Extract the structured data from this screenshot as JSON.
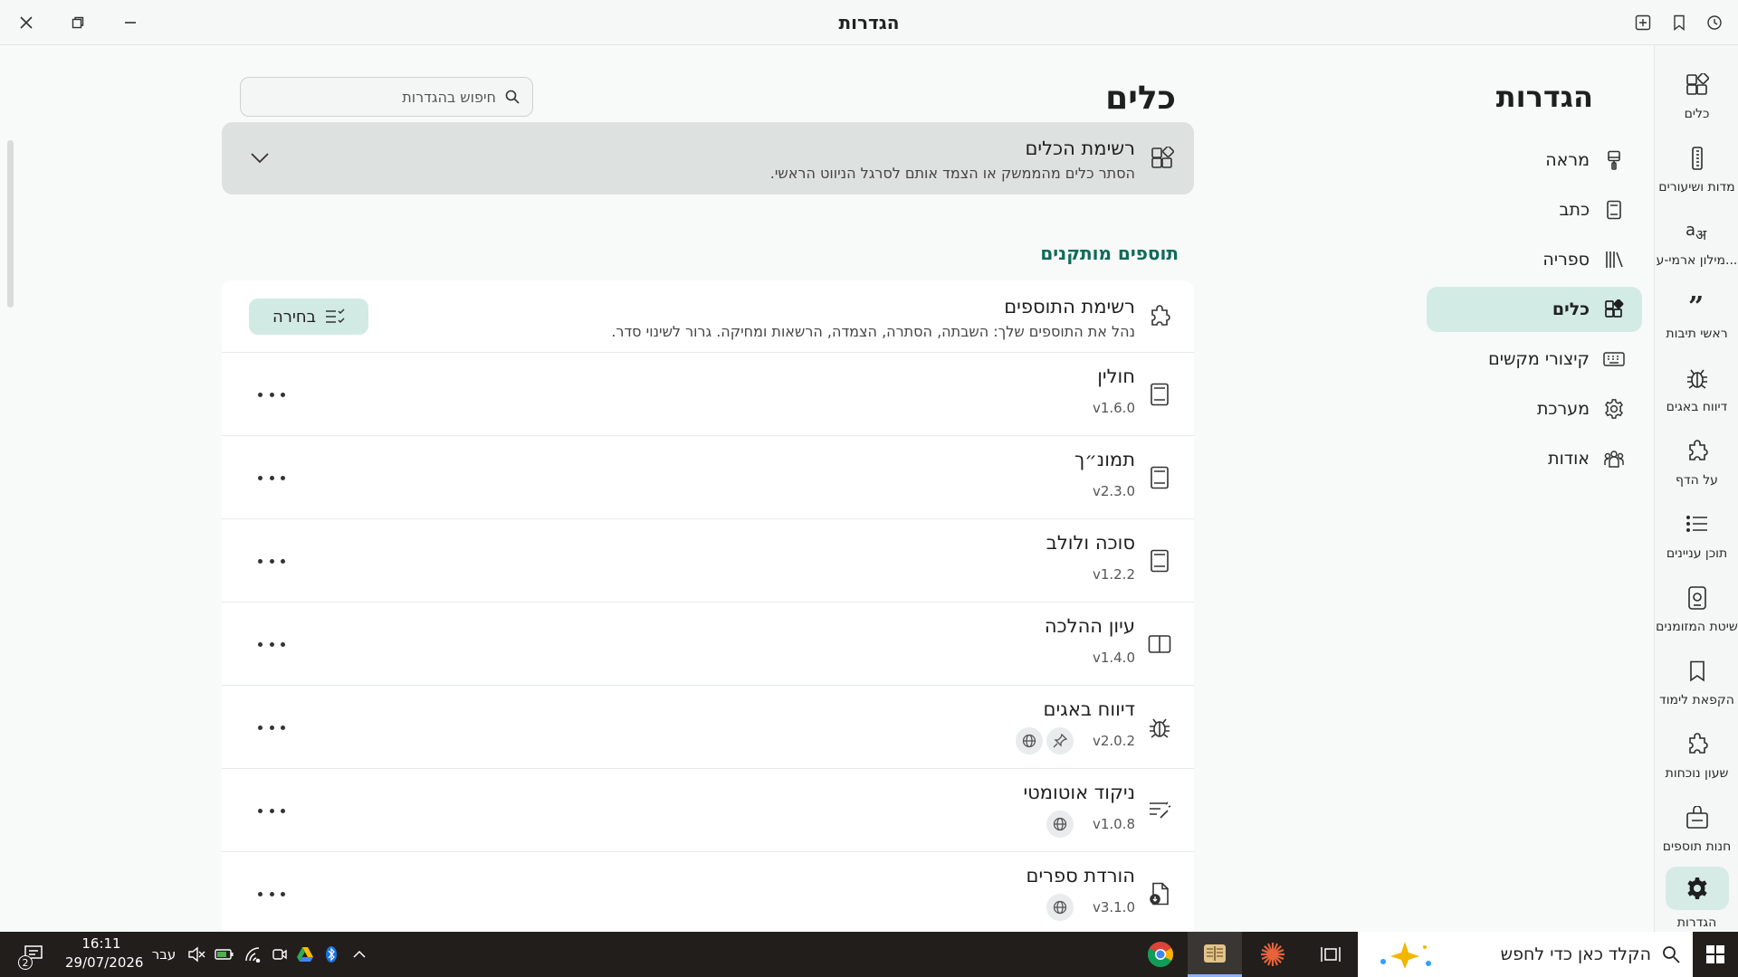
{
  "window": {
    "title": "הגדרות"
  },
  "rail": {
    "items": [
      {
        "label": "כלים",
        "icon": "tools-grid-icon"
      },
      {
        "label": "מדות ושיעורים",
        "icon": "ruler-icon"
      },
      {
        "label": "מילון ארמי-ע...",
        "icon": "translate-icon"
      },
      {
        "label": "ראשי תיבות",
        "icon": "quote-icon"
      },
      {
        "label": "דיווח באגים",
        "icon": "bug-icon"
      },
      {
        "label": "על הדף",
        "icon": "puzzle-icon"
      },
      {
        "label": "תוכן עניינים",
        "icon": "list-icon"
      },
      {
        "label": "שיטת המזומנים",
        "icon": "tablet-icon"
      },
      {
        "label": "הקפאת לימוד",
        "icon": "bookmark-icon"
      },
      {
        "label": "שעון נוכחות",
        "icon": "puzzle-icon"
      },
      {
        "label": "חנות תוספים",
        "icon": "store-icon"
      },
      {
        "label": "הגדרות",
        "icon": "gear-icon"
      }
    ]
  },
  "settings_nav": {
    "title": "הגדרות",
    "items": [
      {
        "label": "מראה",
        "icon": "brush-icon"
      },
      {
        "label": "כתב",
        "icon": "document-icon"
      },
      {
        "label": "ספריה",
        "icon": "library-icon"
      },
      {
        "label": "כלים",
        "icon": "tools-grid-icon"
      },
      {
        "label": "קיצורי מקשים",
        "icon": "keyboard-icon"
      },
      {
        "label": "מערכת",
        "icon": "gear-icon"
      },
      {
        "label": "אודות",
        "icon": "people-icon"
      }
    ],
    "active_index": 3
  },
  "main": {
    "title": "כלים",
    "search_placeholder": "חיפוש בהגדרות",
    "tools_card": {
      "title": "רשימת הכלים",
      "subtitle": "הסתר כלים מהממשק או הצמד אותם לסרגל הניווט הראשי."
    },
    "section_title": "תוספים מותקנים",
    "plugins_header": {
      "title": "רשימת התוספים",
      "subtitle": "נהל את התוספים שלך: השבתה, הסתרה, הצמדה, הרשאות ומחיקה. גרור לשינוי סדר.",
      "select_label": "בחירה"
    },
    "plugins": [
      {
        "name": "חולין",
        "version": "v1.6.0",
        "icon": "book-icon",
        "badges": []
      },
      {
        "name": "תמונ״ך",
        "version": "v2.3.0",
        "icon": "book-icon",
        "badges": []
      },
      {
        "name": "סוכה ולולב",
        "version": "v1.2.2",
        "icon": "book-icon",
        "badges": []
      },
      {
        "name": "עיון ההלכה",
        "version": "v1.4.0",
        "icon": "open-book-icon",
        "badges": []
      },
      {
        "name": "דיווח באגים",
        "version": "v2.0.2",
        "icon": "bug-icon",
        "badges": [
          "pin-icon",
          "globe-icon"
        ]
      },
      {
        "name": "ניקוד אוטומטי",
        "version": "v1.0.8",
        "icon": "magic-text-icon",
        "badges": [
          "globe-icon"
        ]
      },
      {
        "name": "הורדת ספרים",
        "version": "v3.1.0",
        "icon": "download-doc-icon",
        "badges": [
          "globe-icon"
        ]
      }
    ]
  },
  "taskbar": {
    "search_placeholder": "הקלד כאן כדי לחפש",
    "time": "16:11",
    "date": "29/07/2026",
    "language": "עבר",
    "notification_count": "2"
  }
}
